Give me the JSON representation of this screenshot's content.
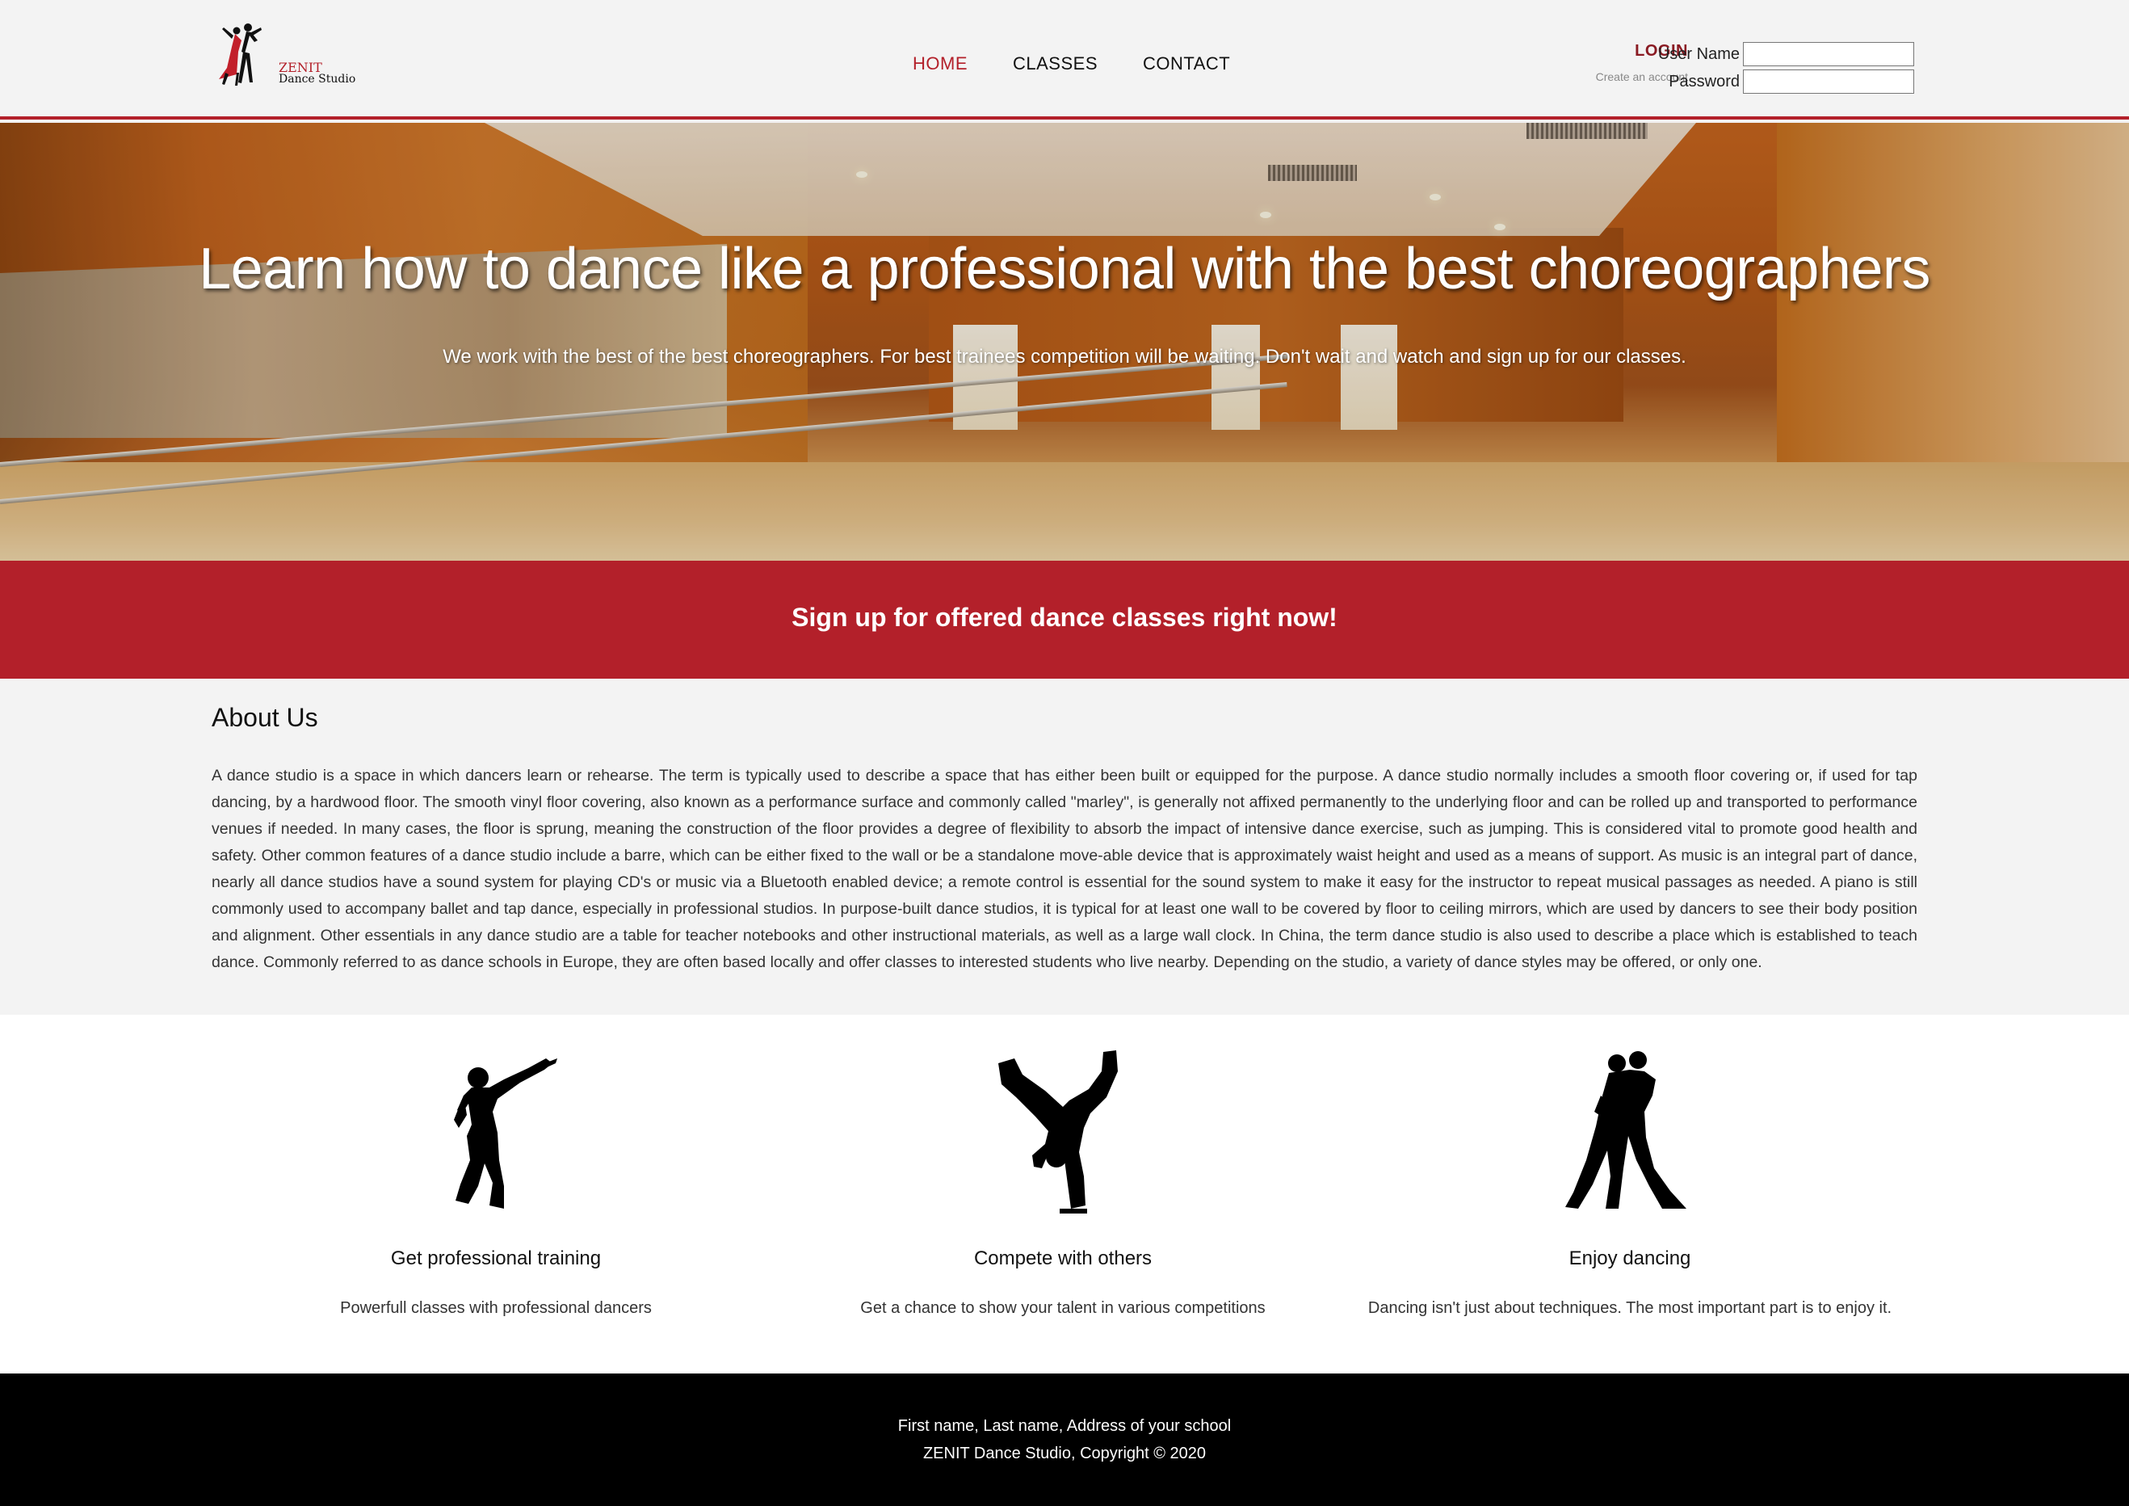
{
  "header": {
    "logo": {
      "line1": "ZENIT",
      "line2": "Dance Studio"
    },
    "nav": [
      {
        "label": "HOME",
        "active": true
      },
      {
        "label": "CLASSES",
        "active": false
      },
      {
        "label": "CONTACT",
        "active": false
      }
    ],
    "login": {
      "title": "LOGIN",
      "create_account": "Create an account",
      "username_label": "User Name",
      "username_value": "",
      "password_label": "Password",
      "password_value": ""
    }
  },
  "hero": {
    "title": "Learn how to dance like a professional with the best choreographers",
    "subtitle": "We work with the best of the best choreographers. For best trainees competition will be waiting. Don't wait and watch and sign up for our classes."
  },
  "signup": {
    "text": "Sign up for offered dance classes right now!"
  },
  "about": {
    "title": "About Us",
    "text": "A dance studio is a space in which dancers learn or rehearse. The term is typically used to describe a space that has either been built or equipped for the purpose. A dance studio normally includes a smooth floor covering or, if used for tap dancing, by a hardwood floor. The smooth vinyl floor covering, also known as a performance surface and commonly called \"marley\", is generally not affixed permanently to the underlying floor and can be rolled up and transported to performance venues if needed. In many cases, the floor is sprung, meaning the construction of the floor provides a degree of flexibility to absorb the impact of intensive dance exercise, such as jumping. This is considered vital to promote good health and safety. Other common features of a dance studio include a barre, which can be either fixed to the wall or be a standalone move-able device that is approximately waist height and used as a means of support. As music is an integral part of dance, nearly all dance studios have a sound system for playing CD's or music via a Bluetooth enabled device; a remote control is essential for the sound system to make it easy for the instructor to repeat musical passages as needed. A piano is still commonly used to accompany ballet and tap dance, especially in professional studios. In purpose-built dance studios, it is typical for at least one wall to be covered by floor to ceiling mirrors, which are used by dancers to see their body position and alignment. Other essentials in any dance studio are a table for teacher notebooks and other instructional materials, as well as a large wall clock. In China, the term dance studio is also used to describe a place which is established to teach dance. Commonly referred to as dance schools in Europe, they are often based locally and offer classes to interested students who live nearby. Depending on the studio, a variety of dance styles may be offered, or only one."
  },
  "features": [
    {
      "icon": "hip-hop-dancer-icon",
      "title": "Get professional training",
      "text": "Powerfull classes with professional dancers"
    },
    {
      "icon": "breakdancer-icon",
      "title": "Compete with others",
      "text": "Get a chance to show your talent in various competitions"
    },
    {
      "icon": "tango-couple-icon",
      "title": "Enjoy dancing",
      "text": "Dancing isn't just about techniques. The most important part is to enjoy it."
    }
  ],
  "footer": {
    "line1": "First name, Last name, Address of your school",
    "line2": "ZENIT Dance Studio, Copyright © 2020"
  },
  "colors": {
    "accent": "#b3202a",
    "background": "#f3f3f3",
    "footer": "#000000"
  }
}
